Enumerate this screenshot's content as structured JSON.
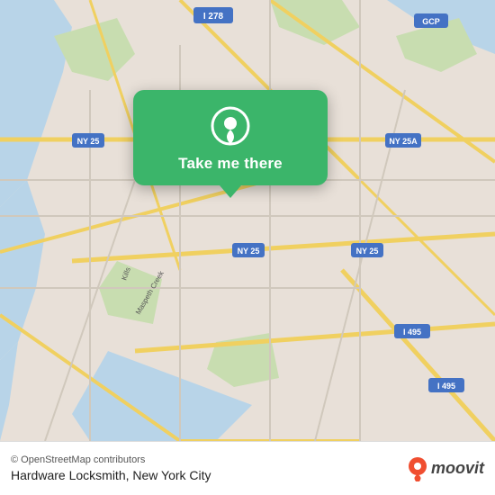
{
  "map": {
    "background_color": "#e8e0d8",
    "attribution": "© OpenStreetMap contributors",
    "place_label": "Hardware Locksmith, New York City"
  },
  "popup": {
    "button_label": "Take me there"
  },
  "moovit": {
    "logo_text": "moovit"
  }
}
